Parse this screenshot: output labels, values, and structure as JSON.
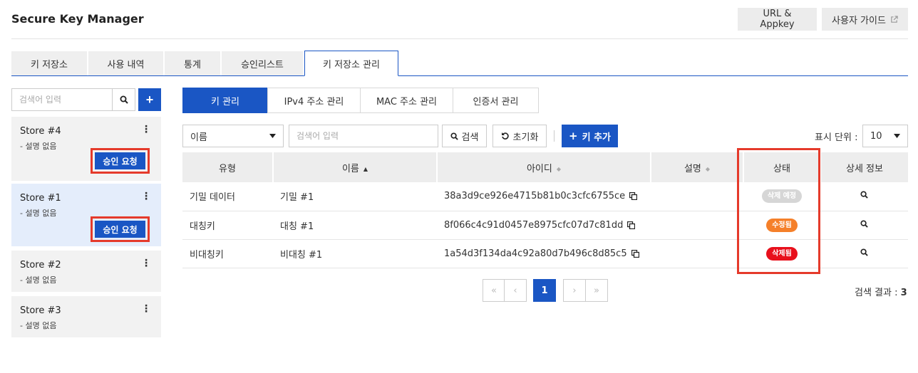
{
  "header": {
    "title": "Secure Key Manager",
    "url_appkey": "URL & Appkey",
    "user_guide": "사용자 가이드"
  },
  "main_tabs": [
    "키 저장소",
    "사용 내역",
    "통계",
    "승인리스트",
    "키 저장소 관리"
  ],
  "main_tabs_active": "키 저장소 관리",
  "left_panel": {
    "search_placeholder": "검색어 입력",
    "add_label": "+",
    "stores": [
      {
        "name": "Store #4",
        "desc": "- 설명 없음",
        "approve": "승인 요청"
      },
      {
        "name": "Store #1",
        "desc": "- 설명 없음",
        "approve": "승인 요청"
      },
      {
        "name": "Store #2",
        "desc": "- 설명 없음"
      },
      {
        "name": "Store #3",
        "desc": "- 설명 없음"
      }
    ]
  },
  "sub_tabs": [
    "키 관리",
    "IPv4 주소 관리",
    "MAC 주소 관리",
    "인증서 관리"
  ],
  "toolbar": {
    "select_value": "이름",
    "search_placeholder": "검색어 입력",
    "search_btn": "검색",
    "reset_btn": "초기화",
    "add_key_btn": "키 추가",
    "unit_label": "표시 단위 :",
    "unit_value": "10"
  },
  "table": {
    "columns": [
      "유형",
      "이름",
      "아이디",
      "설명",
      "상태",
      "상세 정보"
    ],
    "rows": [
      {
        "type": "기밀 데이터",
        "name": "기밀 #1",
        "id": "38a3d9ce926e4715b81b0c3cfc6755ce",
        "desc": "",
        "status": "삭제 예정",
        "status_color": "#d6d6d6"
      },
      {
        "type": "대칭키",
        "name": "대칭 #1",
        "id": "8f066c4c91d0457e8975cfc07d7c81dd",
        "desc": "",
        "status": "수정됨",
        "status_color": "#f5802a"
      },
      {
        "type": "비대칭키",
        "name": "비대칭 #1",
        "id": "1a54d3f134da4c92a80d7b496c8d85c5",
        "desc": "",
        "status": "삭제됨",
        "status_color": "#e8101c"
      }
    ]
  },
  "pagination": {
    "first": "«",
    "prev": "‹",
    "current": "1",
    "next": "›",
    "last": "»"
  },
  "result": {
    "label": "검색 결과 :",
    "count": "3"
  },
  "colors": {
    "primary": "#1a56c4",
    "highlight": "#e53a2b"
  }
}
